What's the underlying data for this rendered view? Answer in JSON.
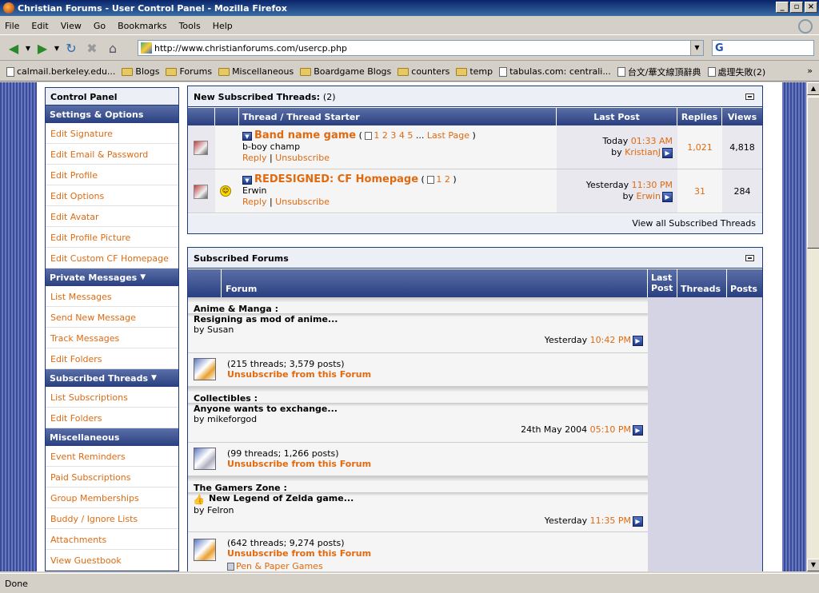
{
  "window": {
    "title": "Christian Forums - User Control Panel - Mozilla Firefox"
  },
  "menu": [
    "File",
    "Edit",
    "View",
    "Go",
    "Bookmarks",
    "Tools",
    "Help"
  ],
  "nav": {
    "url": "http://www.christianforums.com/usercp.php",
    "search_engine_icon": "G"
  },
  "bookmarks": [
    {
      "label": "calmail.berkeley.edu...",
      "type": "page"
    },
    {
      "label": "Blogs",
      "type": "folder"
    },
    {
      "label": "Forums",
      "type": "folder"
    },
    {
      "label": "Miscellaneous",
      "type": "folder"
    },
    {
      "label": "Boardgame Blogs",
      "type": "folder"
    },
    {
      "label": "counters",
      "type": "folder"
    },
    {
      "label": "temp",
      "type": "folder"
    },
    {
      "label": "tabulas.com: centrali...",
      "type": "page"
    },
    {
      "label": "台文/華文線頂辭典",
      "type": "page"
    },
    {
      "label": "處理失敗(2)",
      "type": "page"
    }
  ],
  "status": "Done",
  "control_panel": {
    "title": "Control Panel",
    "settings": {
      "heading": "Settings & Options",
      "items": [
        "Edit Signature",
        "Edit Email & Password",
        "Edit Profile",
        "Edit Options",
        "Edit Avatar",
        "Edit Profile Picture",
        "Edit Custom CF Homepage"
      ]
    },
    "private_messages": {
      "heading": "Private Messages",
      "items": [
        "List Messages",
        "Send New Message",
        "Track Messages",
        "Edit Folders"
      ]
    },
    "subscribed_threads": {
      "heading": "Subscribed Threads",
      "items": [
        "List Subscriptions",
        "Edit Folders"
      ]
    },
    "misc": {
      "heading": "Miscellaneous",
      "items": [
        "Event Reminders",
        "Paid Subscriptions",
        "Group Memberships",
        "Buddy / Ignore Lists",
        "Attachments",
        "View Guestbook"
      ]
    }
  },
  "threads_box": {
    "title": "New Subscribed Threads:",
    "count": "(2)",
    "cols": {
      "thread": "Thread / Thread Starter",
      "last_post": "Last Post",
      "replies": "Replies",
      "views": "Views"
    },
    "rows": [
      {
        "title": "Band name game",
        "pages": [
          "1",
          "2",
          "3",
          "4",
          "5"
        ],
        "ellipsis": "...",
        "last_page": "Last Page",
        "starter": "b-boy champ",
        "reply": "Reply",
        "unsubscribe": "Unsubscribe",
        "day": "Today",
        "time": "01:33 AM",
        "by": "by",
        "user": "KristianJ",
        "replies": "1,021",
        "views": "4,818"
      },
      {
        "title": "REDESIGNED: CF Homepage",
        "pages": [
          "1",
          "2"
        ],
        "starter": "Erwin",
        "reply": "Reply",
        "unsubscribe": "Unsubscribe",
        "day": "Yesterday",
        "time": "11:30 PM",
        "by": "by",
        "user": "Erwin",
        "replies": "31",
        "views": "284"
      }
    ],
    "view_all": "View all Subscribed Threads"
  },
  "forums_box": {
    "title": "Subscribed Forums",
    "cols": {
      "forum": "Forum",
      "last_post_1": "Last",
      "last_post_2": "Post",
      "threads": "Threads",
      "posts": "Posts"
    },
    "forums": [
      {
        "name": "Anime & Manga :",
        "thread": "Resigning as mod of anime...",
        "by": "by Susan",
        "date": "Yesterday",
        "time": "10:42 PM",
        "stats": "(215 threads; 3,579 posts)",
        "unsub": "Unsubscribe from this Forum"
      },
      {
        "name": "Collectibles :",
        "thread": "Anyone wants to exchange...",
        "by": "by mikeforgod",
        "date": "24th May 2004",
        "time": "05:10 PM",
        "stats": "(99 threads; 1,266 posts)",
        "unsub": "Unsubscribe from this Forum"
      },
      {
        "name": "The Gamers Zone :",
        "thread": "New Legend of Zelda game...",
        "by": "by Felron",
        "date": "Yesterday",
        "time": "11:35 PM",
        "stats": "(642 threads; 9,274 posts)",
        "unsub": "Unsubscribe from this Forum",
        "subforum": "Pen & Paper Games"
      }
    ]
  }
}
